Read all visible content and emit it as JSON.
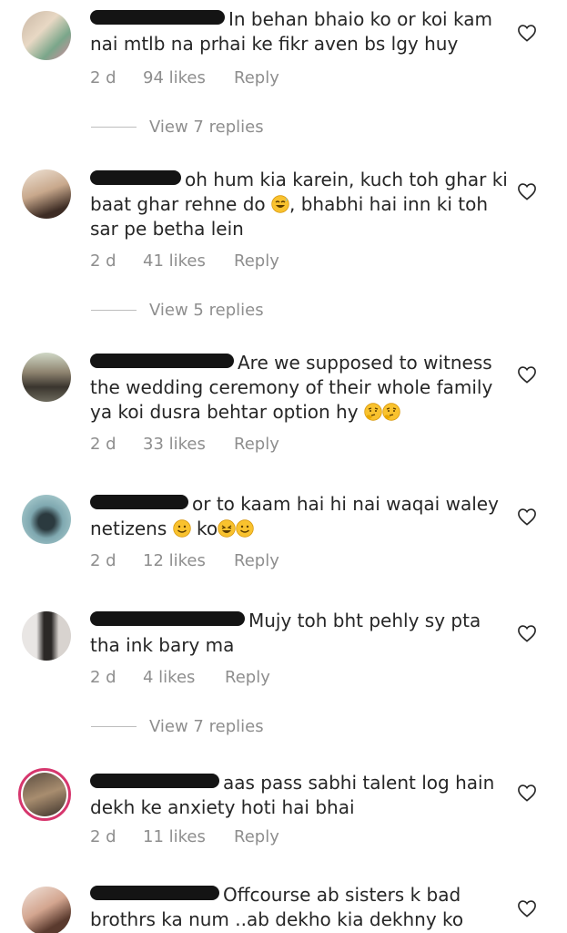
{
  "comments": [
    {
      "text": "In behan bhaio ko or koi kam nai mtlb na prhai ke fikr aven bs lgy huy",
      "age": "2 d",
      "likes": "94 likes",
      "reply": "Reply",
      "view_replies": "View 7 replies"
    },
    {
      "text": "oh hum kia karein, kuch toh ghar ki baat ghar rehne do",
      "text2": ", bhabhi hai inn ki toh sar pe betha lein",
      "age": "2 d",
      "likes": "41 likes",
      "reply": "Reply",
      "view_replies": "View 5 replies"
    },
    {
      "text": "Are we supposed to witness the wedding ceremony of their whole family ya koi dusra behtar option hy",
      "age": "2 d",
      "likes": "33 likes",
      "reply": "Reply"
    },
    {
      "text": "or to kaam hai hi nai waqai waley netizens",
      "text2": "ko",
      "age": "2 d",
      "likes": "12 likes",
      "reply": "Reply"
    },
    {
      "text": "Mujy toh bht pehly sy pta tha ink bary ma",
      "age": "2 d",
      "likes": "4 likes",
      "reply": "Reply",
      "view_replies": "View 7 replies"
    },
    {
      "text": "aas pass sabhi talent log hain dekh ke anxiety hoti hai bhai",
      "age": "2 d",
      "likes": "11 likes",
      "reply": "Reply"
    },
    {
      "text": "Offcourse ab sisters k bad brothrs ka num ..ab dekho kia dekhny ko"
    }
  ],
  "colors": {
    "text": "#262626",
    "meta": "#8e8e8e",
    "redaction": "#141414",
    "story_ring": "#d6366d"
  },
  "icons": [
    "heart-icon",
    "grinning-sweat-emoji",
    "thinking-emoji",
    "smiling-emoji",
    "laughing-emoji"
  ]
}
